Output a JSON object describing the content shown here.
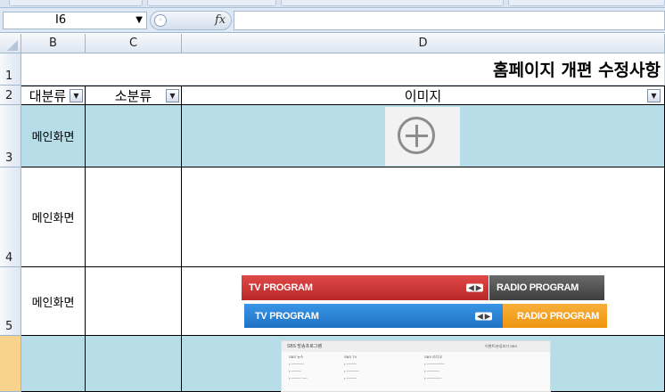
{
  "excel": {
    "name_box": "I6",
    "fx_label": "fx",
    "columns": [
      "B",
      "C",
      "D"
    ],
    "rows": [
      "1",
      "2",
      "3",
      "4",
      "5"
    ]
  },
  "sheet": {
    "title": "홈페이지 개편 수정사항",
    "headers": {
      "major": "대분류",
      "minor": "소분류",
      "image": "이미지"
    },
    "rows": [
      {
        "major": "메인화면",
        "minor": ""
      },
      {
        "major": "메인화면",
        "minor": ""
      },
      {
        "major": "메인화면",
        "minor": ""
      }
    ]
  },
  "images": {
    "tv_red": "TV PROGRAM",
    "radio_gray": "RADIO PROGRAM",
    "tv_blue": "TV PROGRAM",
    "radio_orange": "RADIO PROGRAM",
    "arrows": "◀ ▶",
    "ss_title": "SBS 방송프로그램",
    "ss_col1": "SBS 뉴스",
    "ss_col2": "SBS TV",
    "ss_col3": "SBS 라디오",
    "ss_side": "이벤트/분류보기 SBS"
  },
  "colors": {
    "accent_blue_row": "#b6dde8",
    "tv_red": "#d9393b",
    "tv_blue": "#2d86d9",
    "radio_gray": "#555555",
    "radio_orange": "#f4a21c",
    "selected_row_header": "#f9d28c"
  }
}
